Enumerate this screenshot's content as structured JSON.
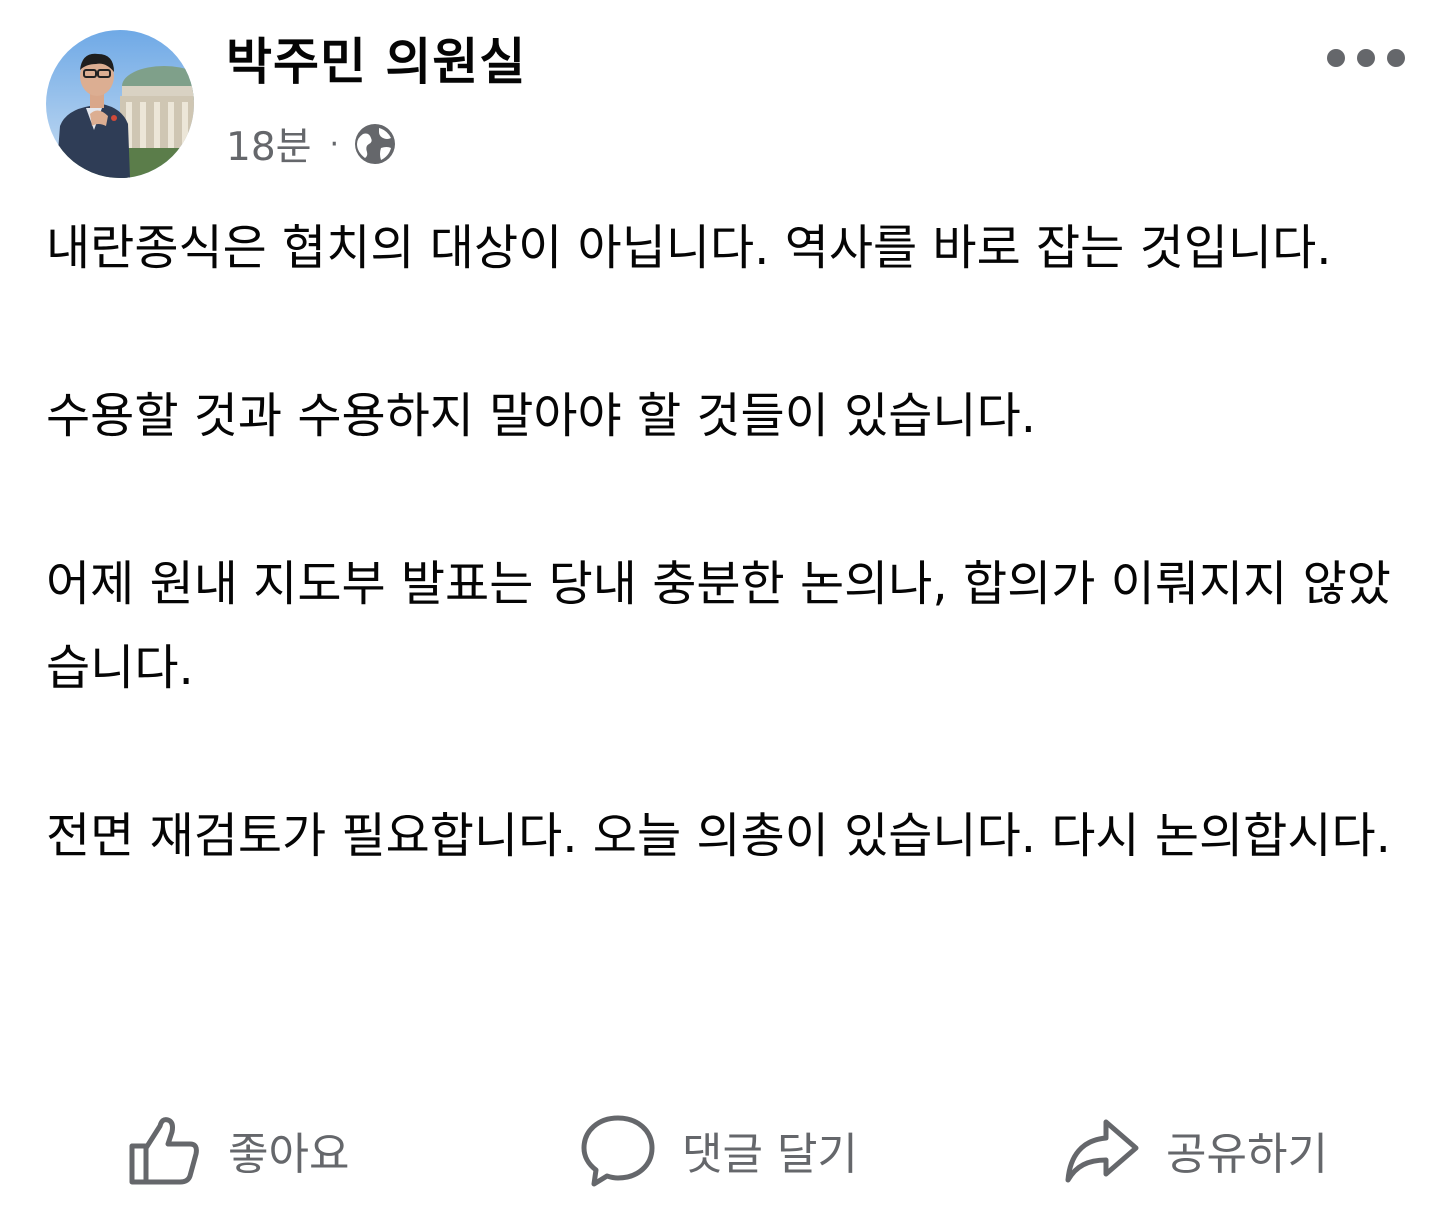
{
  "author": {
    "name": "박주민 의원실",
    "avatar_icon": "profile-photo"
  },
  "meta": {
    "time": "18분",
    "separator": "·",
    "audience_icon": "globe-icon"
  },
  "header": {
    "more_icon": "more-dots-icon"
  },
  "post": {
    "paragraphs": [
      "내란종식은 협치의 대상이 아닙니다. 역사를 바로 잡는 것입니다.",
      "수용할 것과 수용하지 말아야 할 것들이 있습니다.",
      "어제 원내 지도부 발표는 당내 충분한 논의나, 합의가 이뤄지지 않았습니다.",
      "전면 재검토가 필요합니다. 오늘 의총이 있습니다. 다시 논의합시다."
    ]
  },
  "actions": {
    "like_label": "좋아요",
    "comment_label": "댓글 달기",
    "share_label": "공유하기"
  },
  "colors": {
    "text_primary": "#050505",
    "text_secondary": "#65676b",
    "icon_gray": "#65676b"
  }
}
